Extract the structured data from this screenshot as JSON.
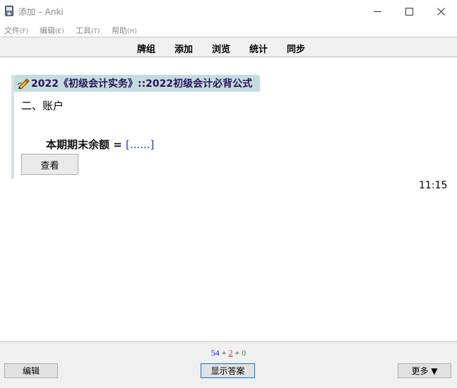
{
  "window": {
    "title": "添加 – Anki",
    "menu": [
      {
        "label": "文件",
        "accel": "(F)"
      },
      {
        "label": "编辑",
        "accel": "(E)"
      },
      {
        "label": "工具",
        "accel": "(T)"
      },
      {
        "label": "帮助",
        "accel": "(H)"
      }
    ]
  },
  "toolbar": {
    "decks": "牌组",
    "add": "添加",
    "browse": "浏览",
    "stats": "统计",
    "sync": "同步"
  },
  "card": {
    "title": "2022《初级会计实务》::2022初级会计必背公式",
    "heading": "二、账户",
    "formula_text": "本期期末余额 = ",
    "cloze": "[......]",
    "view_button": "查看"
  },
  "timer": "11:15",
  "bottom": {
    "counts": {
      "new": "54",
      "learn": "2",
      "review": "0",
      "sep": "+"
    },
    "edit_button": "编辑",
    "show_answer_button": "显示答案",
    "more_button": "更多 ▼"
  },
  "colors": {
    "card_header_bg": "#c4dcde",
    "card_title": "#2b135c",
    "cloze": "#1e31d6",
    "count_new": "#1f1fb8",
    "count_learn": "#cc3333",
    "count_review": "#1a9a1a"
  }
}
